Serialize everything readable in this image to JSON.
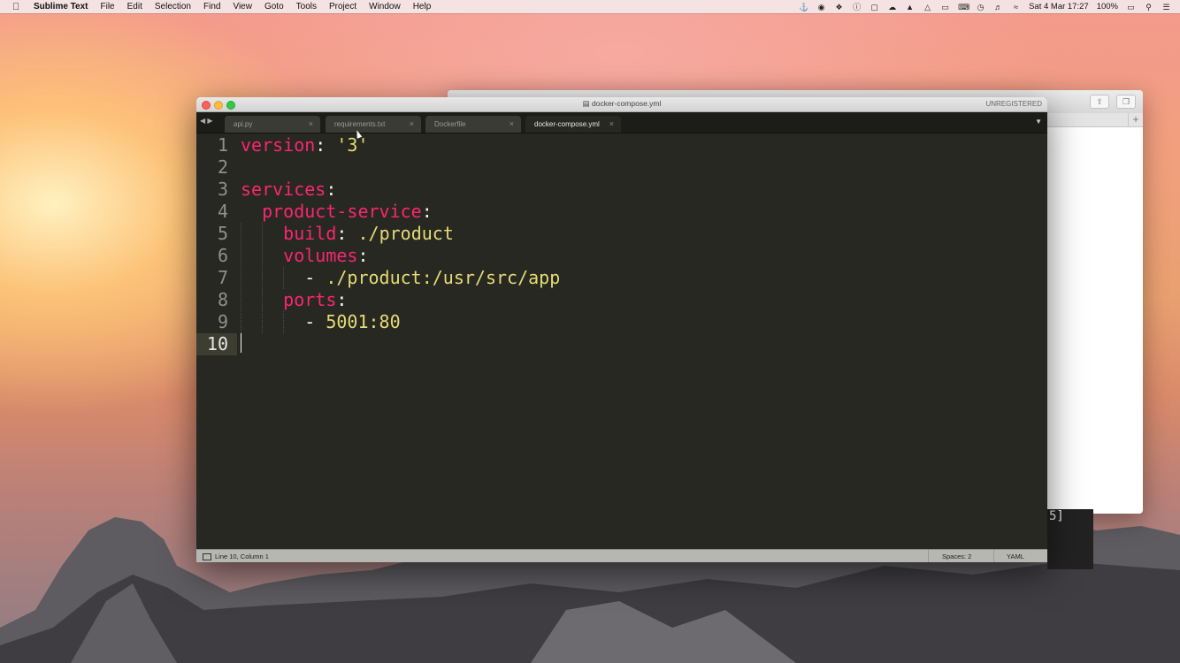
{
  "menubar": {
    "app_name": "Sublime Text",
    "menus": [
      "File",
      "Edit",
      "Selection",
      "Find",
      "View",
      "Goto",
      "Tools",
      "Project",
      "Window",
      "Help"
    ],
    "clock": "Sat 4 Mar  17:27",
    "battery": "100%"
  },
  "window": {
    "title": "docker-compose.yml",
    "registration": "UNREGISTERED",
    "tabs": [
      {
        "label": "api.py",
        "active": false
      },
      {
        "label": "requirements.txt",
        "active": false
      },
      {
        "label": "Dockerfile",
        "active": false
      },
      {
        "label": "docker-compose.yml",
        "active": true
      }
    ]
  },
  "editor": {
    "line_numbers": [
      "1",
      "2",
      "3",
      "4",
      "5",
      "6",
      "7",
      "8",
      "9",
      "10"
    ],
    "current_line": 10,
    "lines": [
      {
        "indent": "",
        "key": "version",
        "sep": ": ",
        "value": "'3'",
        "dash": ""
      },
      {
        "indent": "",
        "key": "",
        "sep": "",
        "value": "",
        "dash": ""
      },
      {
        "indent": "",
        "key": "services",
        "sep": ":",
        "value": "",
        "dash": ""
      },
      {
        "indent": "  ",
        "key": "product-service",
        "sep": ":",
        "value": "",
        "dash": ""
      },
      {
        "indent": "    ",
        "key": "build",
        "sep": ": ",
        "value": "./product",
        "dash": ""
      },
      {
        "indent": "    ",
        "key": "volumes",
        "sep": ":",
        "value": "",
        "dash": ""
      },
      {
        "indent": "      ",
        "key": "",
        "sep": "",
        "value": "./product:/usr/src/app",
        "dash": "- "
      },
      {
        "indent": "    ",
        "key": "ports",
        "sep": ":",
        "value": "",
        "dash": ""
      },
      {
        "indent": "      ",
        "key": "",
        "sep": "",
        "value": "5001:80",
        "dash": "- "
      },
      {
        "indent": "",
        "key": "",
        "sep": "",
        "value": "",
        "dash": ""
      }
    ]
  },
  "statusbar": {
    "position": "Line 10, Column 1",
    "spaces": "Spaces: 2",
    "syntax": "YAML"
  },
  "background_terminal": "5]",
  "colors": {
    "editor_bg": "#272822",
    "keyword": "#f92672",
    "string": "#e6db74",
    "plain": "#f8f8f2",
    "line_number": "#8f908a"
  }
}
